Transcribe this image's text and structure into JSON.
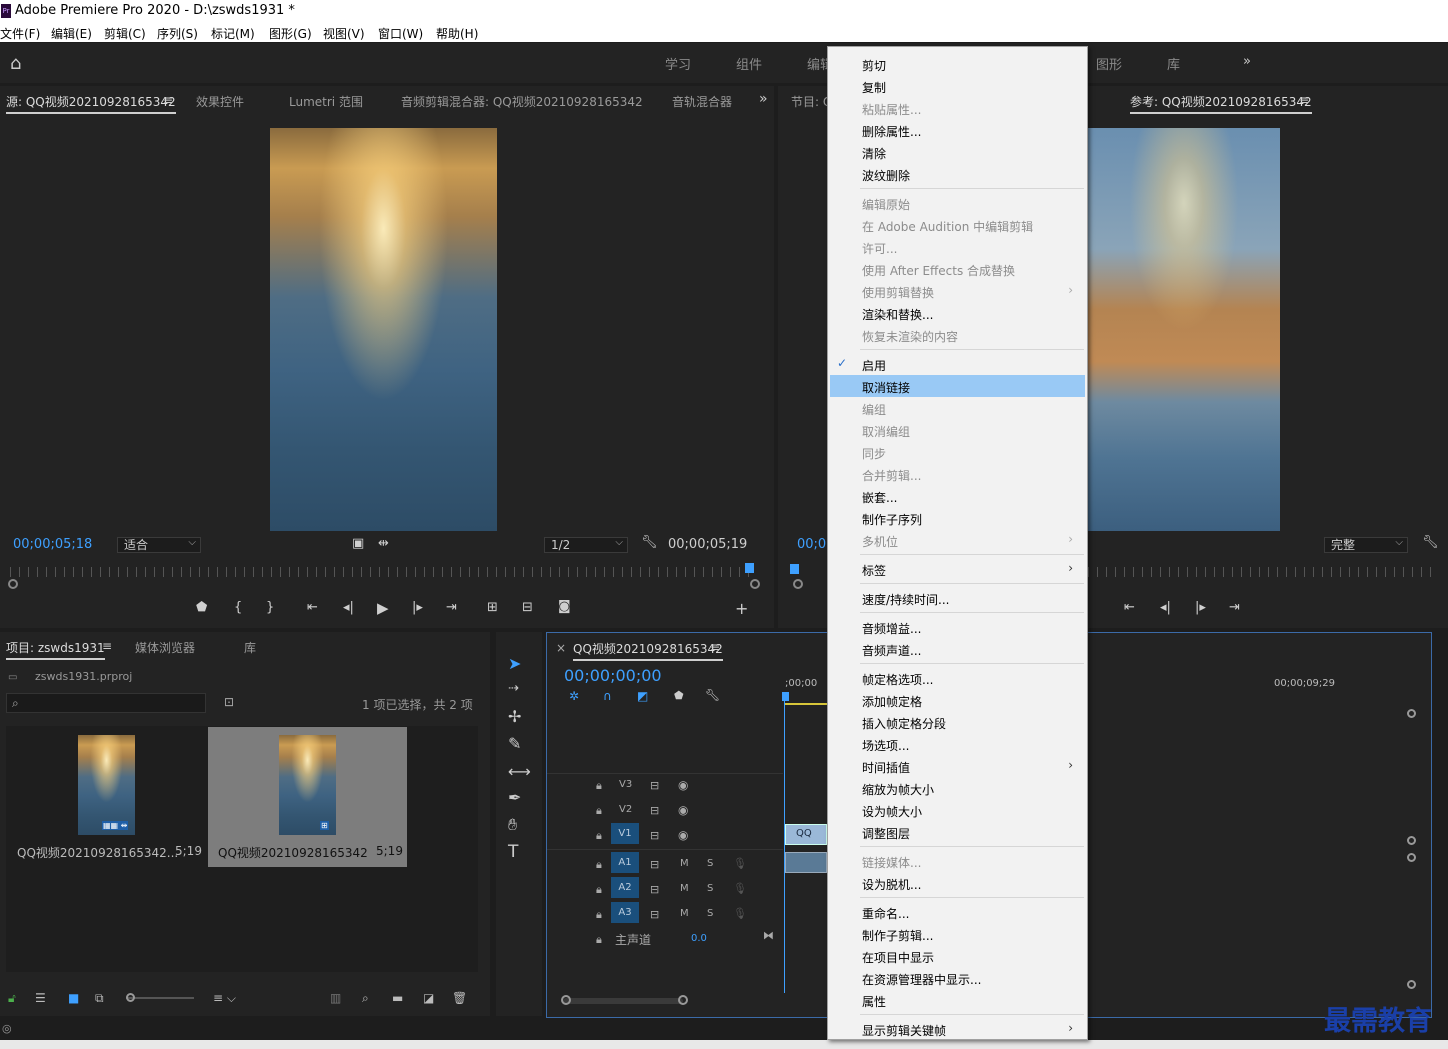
{
  "window": {
    "title": "Adobe Premiere Pro 2020 - D:\\zswds1931 *",
    "logo": "Pr"
  },
  "menubar": [
    "文件(F)",
    "编辑(E)",
    "剪辑(C)",
    "序列(S)",
    "标记(M)",
    "图形(G)",
    "视图(V)",
    "窗口(W)",
    "帮助(H)"
  ],
  "workspaces": [
    "学习",
    "组件",
    "编辑",
    "图形",
    "库"
  ],
  "workspace_more": "»",
  "source_panel": {
    "tabs": [
      "源: QQ视频20210928165342",
      "效果控件",
      "Lumetri 范围",
      "音频剪辑混合器: QQ视频20210928165342",
      "音轨混合器"
    ],
    "menu_icon": "≡",
    "more": "»",
    "timecode_in": "00;00;05;18",
    "fit_label": "适合",
    "resolution": "1/2",
    "timecode_out": "00;00;05;19"
  },
  "program_panel": {
    "tab": "节目: Q",
    "reference_tab": "参考: QQ视频20210928165342",
    "timecode": "00;0",
    "fit_label": "完整"
  },
  "project_panel": {
    "tabs": [
      "项目: zswds1931",
      "媒体浏览器",
      "库"
    ],
    "project_file": "zswds1931.prproj",
    "selection_info": "1 项已选择，共 2 项",
    "items": [
      {
        "name": "QQ视频20210928165342...",
        "duration": "5;19",
        "selected": false
      },
      {
        "name": "QQ视频20210928165342",
        "duration": "5;19",
        "selected": true
      }
    ]
  },
  "timeline": {
    "close": "×",
    "tab": "QQ视频20210928165342",
    "timecode": "00;00;00;00",
    "ruler_start": ";00;00",
    "ruler_end": "00;00;09;29",
    "video_tracks": [
      "V3",
      "V2",
      "V1"
    ],
    "audio_tracks": [
      "A1",
      "A2",
      "A3"
    ],
    "master_label": "主声道",
    "master_value": "0.0",
    "clip_label": "QQ",
    "m": "M",
    "s": "S"
  },
  "context_menu": {
    "groups": [
      [
        {
          "label": "剪切",
          "enabled": true
        },
        {
          "label": "复制",
          "enabled": true
        },
        {
          "label": "粘贴属性...",
          "enabled": false
        },
        {
          "label": "删除属性...",
          "enabled": true
        },
        {
          "label": "清除",
          "enabled": true
        },
        {
          "label": "波纹删除",
          "enabled": true
        }
      ],
      [
        {
          "label": "编辑原始",
          "enabled": false
        },
        {
          "label": "在 Adobe Audition 中编辑剪辑",
          "enabled": false
        },
        {
          "label": "许可...",
          "enabled": false
        },
        {
          "label": "使用 After Effects 合成替换",
          "enabled": false
        },
        {
          "label": "使用剪辑替换",
          "enabled": false,
          "submenu": true
        },
        {
          "label": "渲染和替换...",
          "enabled": true
        },
        {
          "label": "恢复未渲染的内容",
          "enabled": false
        }
      ],
      [
        {
          "label": "启用",
          "enabled": true,
          "checked": true
        },
        {
          "label": "取消链接",
          "enabled": true,
          "highlighted": true
        },
        {
          "label": "编组",
          "enabled": false
        },
        {
          "label": "取消编组",
          "enabled": false
        },
        {
          "label": "同步",
          "enabled": false
        },
        {
          "label": "合并剪辑...",
          "enabled": false
        },
        {
          "label": "嵌套...",
          "enabled": true
        },
        {
          "label": "制作子序列",
          "enabled": true
        },
        {
          "label": "多机位",
          "enabled": false,
          "submenu": true
        }
      ],
      [
        {
          "label": "标签",
          "enabled": true,
          "submenu": true
        }
      ],
      [
        {
          "label": "速度/持续时间...",
          "enabled": true
        }
      ],
      [
        {
          "label": "音频增益...",
          "enabled": true
        },
        {
          "label": "音频声道...",
          "enabled": true
        }
      ],
      [
        {
          "label": "帧定格选项...",
          "enabled": true
        },
        {
          "label": "添加帧定格",
          "enabled": true
        },
        {
          "label": "插入帧定格分段",
          "enabled": true
        },
        {
          "label": "场选项...",
          "enabled": true
        },
        {
          "label": "时间插值",
          "enabled": true,
          "submenu": true
        },
        {
          "label": "缩放为帧大小",
          "enabled": true
        },
        {
          "label": "设为帧大小",
          "enabled": true
        },
        {
          "label": "调整图层",
          "enabled": true
        }
      ],
      [
        {
          "label": "链接媒体...",
          "enabled": false
        },
        {
          "label": "设为脱机...",
          "enabled": true
        }
      ],
      [
        {
          "label": "重命名...",
          "enabled": true
        },
        {
          "label": "制作子剪辑...",
          "enabled": true
        },
        {
          "label": "在项目中显示",
          "enabled": true
        },
        {
          "label": "在资源管理器中显示...",
          "enabled": true
        },
        {
          "label": "属性",
          "enabled": true
        }
      ],
      [
        {
          "label": "显示剪辑关键帧",
          "enabled": true,
          "submenu": true
        }
      ]
    ]
  },
  "watermark": "最需教育",
  "colors": {
    "accent_timecode": "#3ea0ff",
    "menu_highlight": "#99c9f5",
    "track_target": "#1a4f7c"
  }
}
